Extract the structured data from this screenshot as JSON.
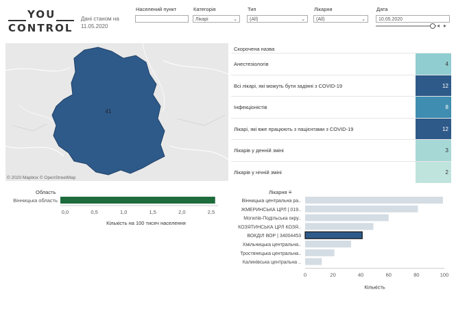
{
  "logo": {
    "line1": "YOU",
    "line2": "CONTROL"
  },
  "as_of": {
    "line1": "Дані станом на",
    "line2": "11.05.2020"
  },
  "filters": {
    "city": {
      "label": "Населений пункт",
      "value": ""
    },
    "category": {
      "label": "Категорія",
      "value": "Лікарі"
    },
    "type": {
      "label": "Тип",
      "value": "(All)"
    },
    "hospital": {
      "label": "Лікарня",
      "value": "(All)"
    },
    "date": {
      "label": "Дата",
      "value": "10.05.2020",
      "step_back": "◂",
      "step_fwd": "▸"
    }
  },
  "map": {
    "region_value": "41",
    "attribution": "© 2020 Mapbox  © OpenStreetMap",
    "fill": "#2e5a8a"
  },
  "short_table": {
    "header": "Скорочена назва",
    "rows": [
      {
        "label": "Анестезіологів",
        "value": "4",
        "color": "#8fcdd0",
        "text_color": "#333"
      },
      {
        "label": "Всі лікарі, які можуть бути задіяні з COVID-19",
        "value": "12",
        "color": "#2e5a8a",
        "text_color": "#fff"
      },
      {
        "label": "Інфекціоністів",
        "value": "8",
        "color": "#3f8db0",
        "text_color": "#fff"
      },
      {
        "label": "Лікарі, які вже працюють з пацієнтами з COVID-19",
        "value": "12",
        "color": "#2e5a8a",
        "text_color": "#fff"
      },
      {
        "label": "Лікарів у денній зміні",
        "value": "3",
        "color": "#a6d8d6",
        "text_color": "#333"
      },
      {
        "label": "Лікарів у нічній зміні",
        "value": "2",
        "color": "#bfe4dd",
        "text_color": "#333"
      }
    ]
  },
  "chart_data": [
    {
      "type": "bar",
      "title": "Область",
      "categories": [
        "Вінницька область"
      ],
      "values": [
        2.65
      ],
      "xlabel": "Кількість на 100 тисяч населення",
      "xlim": [
        0,
        2.7
      ],
      "ticks": [
        "0,0",
        "0,5",
        "1,0",
        "1,5",
        "2,0",
        "2,5"
      ],
      "color": "#1e6b3c"
    },
    {
      "type": "bar",
      "title": "Лікарня",
      "categories": [
        "Вінницька центральна ра..",
        "ЖМЕРИНСЬКА ЦРЛ | 019..",
        "Могилів-Подільська окру..",
        "КОЗЯТИНСЬКА ЦРЛ КОЗЯ..",
        "ВОКДІЛ ВОР | 34004453",
        "Хмільницька центральна..",
        "Тростянецька центральна..",
        "Калинівська центральна .."
      ],
      "values": [
        99,
        81,
        60,
        49,
        41,
        33,
        21,
        12
      ],
      "highlight": 4,
      "xlabel": "Кількість",
      "xlim": [
        0,
        100
      ],
      "ticks": [
        "0",
        "20",
        "40",
        "60",
        "80",
        "100"
      ],
      "color": "#d4dce4",
      "highlight_color": "#2e5a8a"
    }
  ]
}
